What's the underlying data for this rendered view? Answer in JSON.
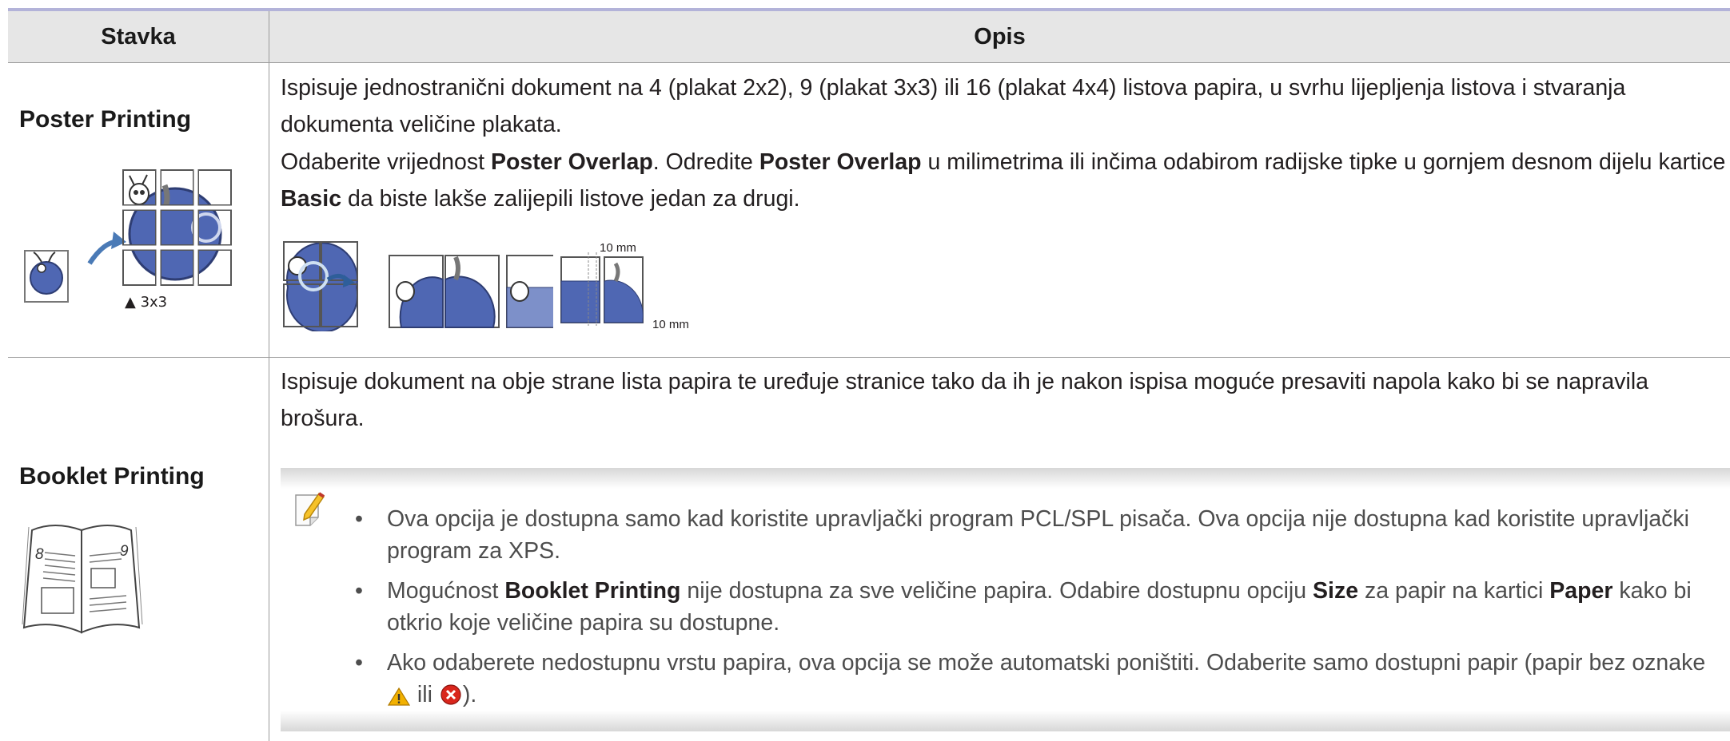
{
  "table": {
    "headers": {
      "item": "Stavka",
      "description": "Opis"
    },
    "rows": [
      {
        "item": "Poster Printing",
        "illustration_label": "▲ 3x3",
        "p1": "Ispisuje jednostranični dokument na 4 (plakat 2x2), 9 (plakat 3x3) ili 16 (plakat 4x4) listova papira, u svrhu lijepljenja listova i stvaranja dokumenta veličine plakata.",
        "p2": {
          "t1": "Odaberite vrijednost ",
          "b1": "Poster Overlap",
          "t2": ". Odredite ",
          "b2": "Poster Overlap",
          "t3": " u milimetrima ili inčima odabirom radijske tipke u gornjem desnom dijelu kartice ",
          "b3": "Basic",
          "t4": " da biste lakše zalijepili listove jedan za drugi."
        },
        "overlap_label_top": "10 mm",
        "overlap_label_right": "10 mm"
      },
      {
        "item": "Booklet Printing",
        "booklet_page_left": "8",
        "booklet_page_right": "9",
        "p1": "Ispisuje dokument na obje strane lista papira te uređuje stranice tako da ih je nakon ispisa moguće presaviti napola kako bi se napravila brošura.",
        "notes": {
          "n1": "Ova opcija je dostupna samo kad koristite upravljački program PCL/SPL pisača. Ova opcija nije dostupna kad koristite upravljački program za XPS.",
          "n2": {
            "t1": "Mogućnost ",
            "b1": "Booklet Printing",
            "t2": " nije dostupna za sve veličine papira. Odabire dostupnu opciju ",
            "b2": "Size",
            "t3": " za papir na kartici ",
            "b3": "Paper",
            "t4": " kako bi otkrio koje veličine papira su dostupne."
          },
          "n3": {
            "t1": "Ako odaberete nedostupnu vrstu papira, ova opcija se može automatski poništiti. Odaberite samo dostupni papir (papir bez oznake ",
            "t2": " ili ",
            "t3": ")."
          }
        }
      }
    ]
  },
  "icons": {
    "note": "note-pencil-icon",
    "warning": "warning-triangle-icon",
    "error": "error-circle-icon"
  },
  "colors": {
    "header_bg": "#e6e6e6",
    "top_rule": "#b3b3d9",
    "apple_blue": "#4f67b3",
    "arrow_blue": "#4a7ab6",
    "warning": "#f2b100",
    "error": "#d9261c"
  }
}
